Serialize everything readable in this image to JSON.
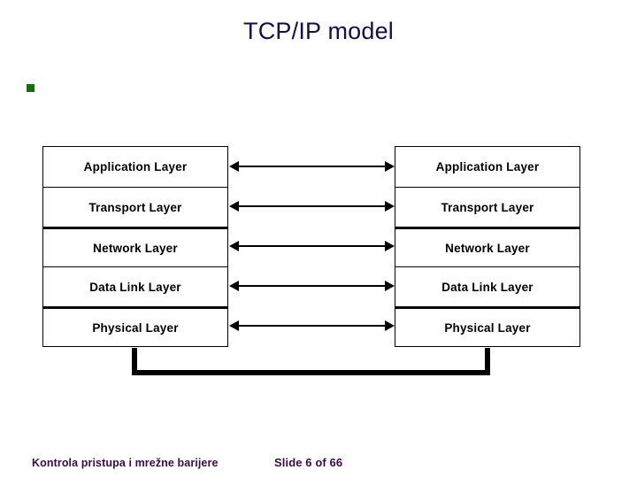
{
  "slide": {
    "title": "TCP/IP model",
    "bullet": {
      "marker": "square-bullet",
      "text": ""
    }
  },
  "diagram": {
    "type": "layered-stack-comparison",
    "left_stack": {
      "name": "host-a-protocol-stack",
      "layers": [
        "Application Layer",
        "Transport Layer",
        "Network Layer",
        "Data Link Layer",
        "Physical Layer"
      ]
    },
    "right_stack": {
      "name": "host-b-protocol-stack",
      "layers": [
        "Application Layer",
        "Transport Layer",
        "Network Layer",
        "Data Link Layer",
        "Physical Layer"
      ]
    },
    "peer_arrows": {
      "count": 5,
      "style": "double-headed",
      "labels": [
        "",
        "",
        "",
        "",
        ""
      ]
    },
    "physical_connection": {
      "name": "physical-medium-link",
      "label": ""
    },
    "colors": {
      "title": "#111144",
      "bullet": "#1a6b14",
      "box_border": "#000000",
      "layer_text": "#000000",
      "arrow": "#000000",
      "footer": "#3b0b4a",
      "background": "#ffffff"
    }
  },
  "footer": {
    "subject": "Kontrola pristupa i mrežne barijere",
    "slide_counter": "Slide 6 of 66"
  }
}
